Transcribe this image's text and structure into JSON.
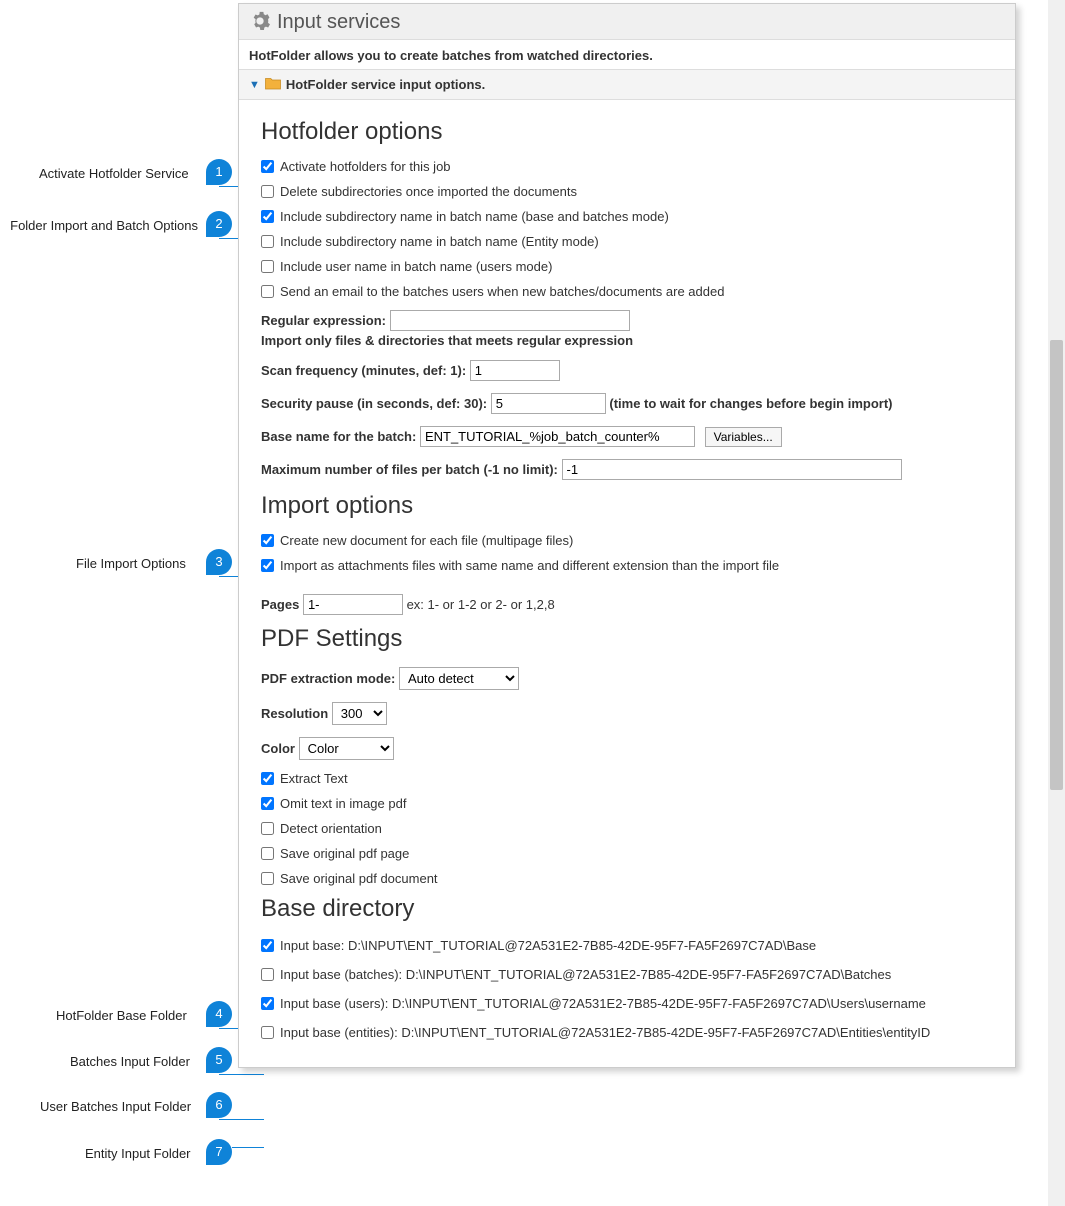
{
  "panel": {
    "title": "Input services",
    "subtitle": "HotFolder allows you to create batches from watched directories.",
    "strip": "HotFolder service input options."
  },
  "annotations": {
    "a1": "Activate Hotfolder Service",
    "a2": "Folder Import and Batch Options",
    "a3": "File Import Options",
    "a4": "HotFolder Base Folder",
    "a5": "Batches Input Folder",
    "a6": "User Batches Input Folder",
    "a7": "Entity Input Folder",
    "n1": "1",
    "n2": "2",
    "n3": "3",
    "n4": "4",
    "n5": "5",
    "n6": "6",
    "n7": "7"
  },
  "hotfolder": {
    "heading": "Hotfolder options",
    "cb1": {
      "label": "Activate hotfolders for this job",
      "checked": true
    },
    "cb2": {
      "label": "Delete subdirectories once imported the documents",
      "checked": false
    },
    "cb3": {
      "label": "Include subdirectory name in batch name (base and batches mode)",
      "checked": true
    },
    "cb4": {
      "label": "Include subdirectory name in batch name (Entity mode)",
      "checked": false
    },
    "cb5": {
      "label": "Include user name in batch name (users mode)",
      "checked": false
    },
    "cb6": {
      "label": "Send an email to the batches users when new batches/documents are added",
      "checked": false
    },
    "regex_label": "Regular expression:",
    "regex_value": "",
    "regex_hint": "Import only files & directories that meets regular expression",
    "scan_label": "Scan frequency (minutes, def: 1):",
    "scan_value": "1",
    "pause_label": "Security pause (in seconds, def: 30):",
    "pause_value": "5",
    "pause_hint": "(time to wait for changes before begin import)",
    "basename_label": "Base name for the batch:",
    "basename_value": "ENT_TUTORIAL_%job_batch_counter%",
    "variables_btn": "Variables...",
    "maxfiles_label": "Maximum number of files per batch (-1 no limit):",
    "maxfiles_value": "-1"
  },
  "import": {
    "heading": "Import options",
    "cb1": {
      "label": "Create new document for each file (multipage files)",
      "checked": true
    },
    "cb2": {
      "label": "Import as attachments files with same name and different extension than the import file",
      "checked": true
    },
    "pages_label": "Pages",
    "pages_value": "1-",
    "pages_hint": "ex: 1- or 1-2 or 2- or 1,2,8"
  },
  "pdf": {
    "heading": "PDF Settings",
    "mode_label": "PDF extraction mode:",
    "mode_value": "Auto detect",
    "res_label": "Resolution",
    "res_value": "300",
    "color_label": "Color",
    "color_value": "Color",
    "cb_extract": {
      "label": "Extract Text",
      "checked": true
    },
    "cb_omit": {
      "label": "Omit text in image pdf",
      "checked": true
    },
    "cb_orient": {
      "label": "Detect orientation",
      "checked": false
    },
    "cb_savepage": {
      "label": "Save original pdf page",
      "checked": false
    },
    "cb_savedoc": {
      "label": "Save original pdf document",
      "checked": false
    }
  },
  "base": {
    "heading": "Base directory",
    "cb_base": {
      "label": "Input base: D:\\INPUT\\ENT_TUTORIAL@72A531E2-7B85-42DE-95F7-FA5F2697C7AD\\Base",
      "checked": true
    },
    "cb_batches": {
      "label": "Input base (batches): D:\\INPUT\\ENT_TUTORIAL@72A531E2-7B85-42DE-95F7-FA5F2697C7AD\\Batches",
      "checked": false
    },
    "cb_users": {
      "label": "Input base (users): D:\\INPUT\\ENT_TUTORIAL@72A531E2-7B85-42DE-95F7-FA5F2697C7AD\\Users\\username",
      "checked": true
    },
    "cb_entities": {
      "label": "Input base (entities): D:\\INPUT\\ENT_TUTORIAL@72A531E2-7B85-42DE-95F7-FA5F2697C7AD\\Entities\\entityID",
      "checked": false
    }
  }
}
